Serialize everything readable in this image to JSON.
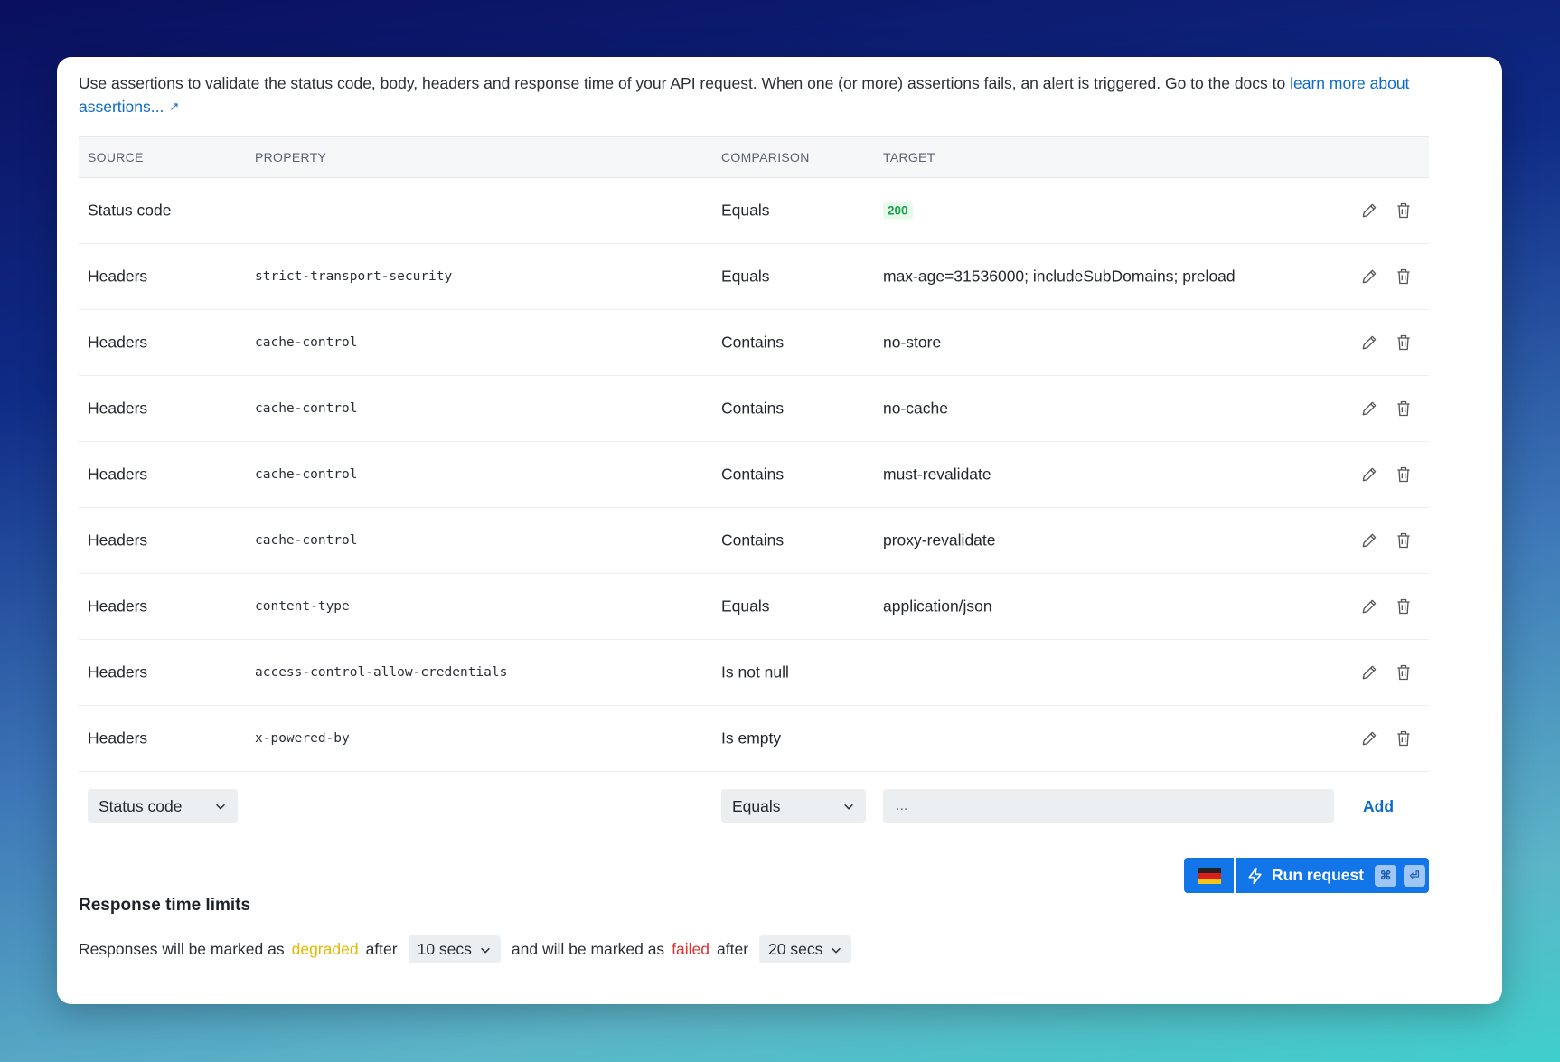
{
  "intro": {
    "text": "Use assertions to validate the status code, body, headers and response time of your API request. When one (or more) assertions fails, an alert is triggered. Go to the docs to ",
    "link": "learn more about assertions..."
  },
  "table": {
    "headers": [
      "SOURCE",
      "PROPERTY",
      "COMPARISON",
      "TARGET"
    ],
    "rows": [
      {
        "source": "Status code",
        "property": "",
        "comparison": "Equals",
        "target": "200",
        "badge": true
      },
      {
        "source": "Headers",
        "property": "strict-transport-security",
        "comparison": "Equals",
        "target": "max-age=31536000; includeSubDomains; preload"
      },
      {
        "source": "Headers",
        "property": "cache-control",
        "comparison": "Contains",
        "target": "no-store"
      },
      {
        "source": "Headers",
        "property": "cache-control",
        "comparison": "Contains",
        "target": "no-cache"
      },
      {
        "source": "Headers",
        "property": "cache-control",
        "comparison": "Contains",
        "target": "must-revalidate"
      },
      {
        "source": "Headers",
        "property": "cache-control",
        "comparison": "Contains",
        "target": "proxy-revalidate"
      },
      {
        "source": "Headers",
        "property": "content-type",
        "comparison": "Equals",
        "target": "application/json"
      },
      {
        "source": "Headers",
        "property": "access-control-allow-credentials",
        "comparison": "Is not null",
        "target": ""
      },
      {
        "source": "Headers",
        "property": "x-powered-by",
        "comparison": "Is empty",
        "target": ""
      }
    ]
  },
  "add_row": {
    "source": "Status code",
    "comparison": "Equals",
    "target_placeholder": "...",
    "add_label": "Add"
  },
  "run": {
    "label": "Run request",
    "kbd1": "⌘",
    "kbd2": "⏎"
  },
  "limits": {
    "title": "Response time limits",
    "p1": "Responses will be marked as",
    "degraded": "degraded",
    "after1": "after",
    "degraded_value": "10 secs",
    "p2": "and will be marked as",
    "failed": "failed",
    "after2": "after",
    "failed_value": "20 secs"
  },
  "colors": {
    "accent": "#1276e8",
    "link": "#0b6bcb",
    "degraded": "#e5b800",
    "failed": "#e03131",
    "success": "#1aa34a"
  }
}
